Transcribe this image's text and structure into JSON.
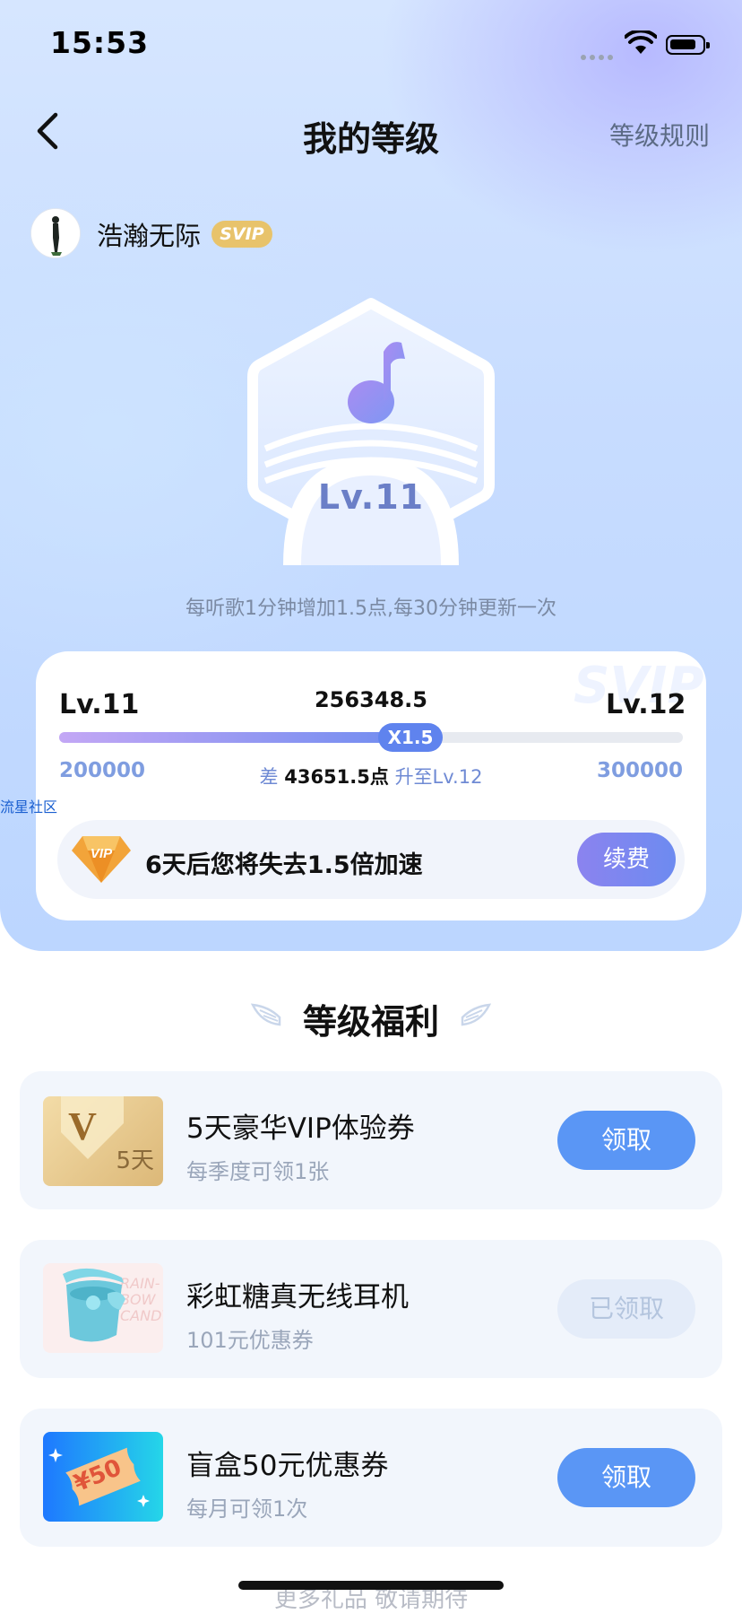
{
  "status_bar": {
    "time": "15:53"
  },
  "nav": {
    "title": "我的等级",
    "rules_link": "等级规则"
  },
  "user": {
    "name": "浩瀚无际",
    "badge": "SVIP"
  },
  "level_badge": {
    "level": "Lv.11"
  },
  "hint": "每听歌1分钟增加1.5点,每30分钟更新一次",
  "progress_card": {
    "watermark": "SVIP",
    "current_level": "Lv.11",
    "next_level": "Lv.12",
    "points": "256348.5",
    "multiplier": "X1.5",
    "min_points": "200000",
    "max_points": "300000",
    "progress": 0.5635,
    "gap_prefix": "差",
    "gap_value": "43651.5点",
    "gap_suffix": "升至Lv.12",
    "vip_notice": "6天后您将失去1.5倍加速",
    "renew_label": "续费"
  },
  "overlay_watermark": "流星社区",
  "benefits": {
    "heading": "等级福利",
    "items": [
      {
        "title": "5天豪华VIP体验券",
        "subtitle": "每季度可领1张",
        "thumb_text": "5天",
        "button": "领取",
        "claimed": false
      },
      {
        "title": "彩虹糖真无线耳机",
        "subtitle": "101元优惠券",
        "thumb_text": "RAIN-BOW CANDY",
        "button": "已领取",
        "claimed": true
      },
      {
        "title": "盲盒50元优惠券",
        "subtitle": "每月可领1次",
        "thumb_text": "¥50",
        "button": "领取",
        "claimed": false
      }
    ],
    "footer": "更多礼品 敬请期待"
  },
  "colors": {
    "accent": "#5a96f5",
    "svip_gold": "#e8c36b",
    "progress_start": "#c3a7f5",
    "progress_end": "#6f8cf0"
  }
}
